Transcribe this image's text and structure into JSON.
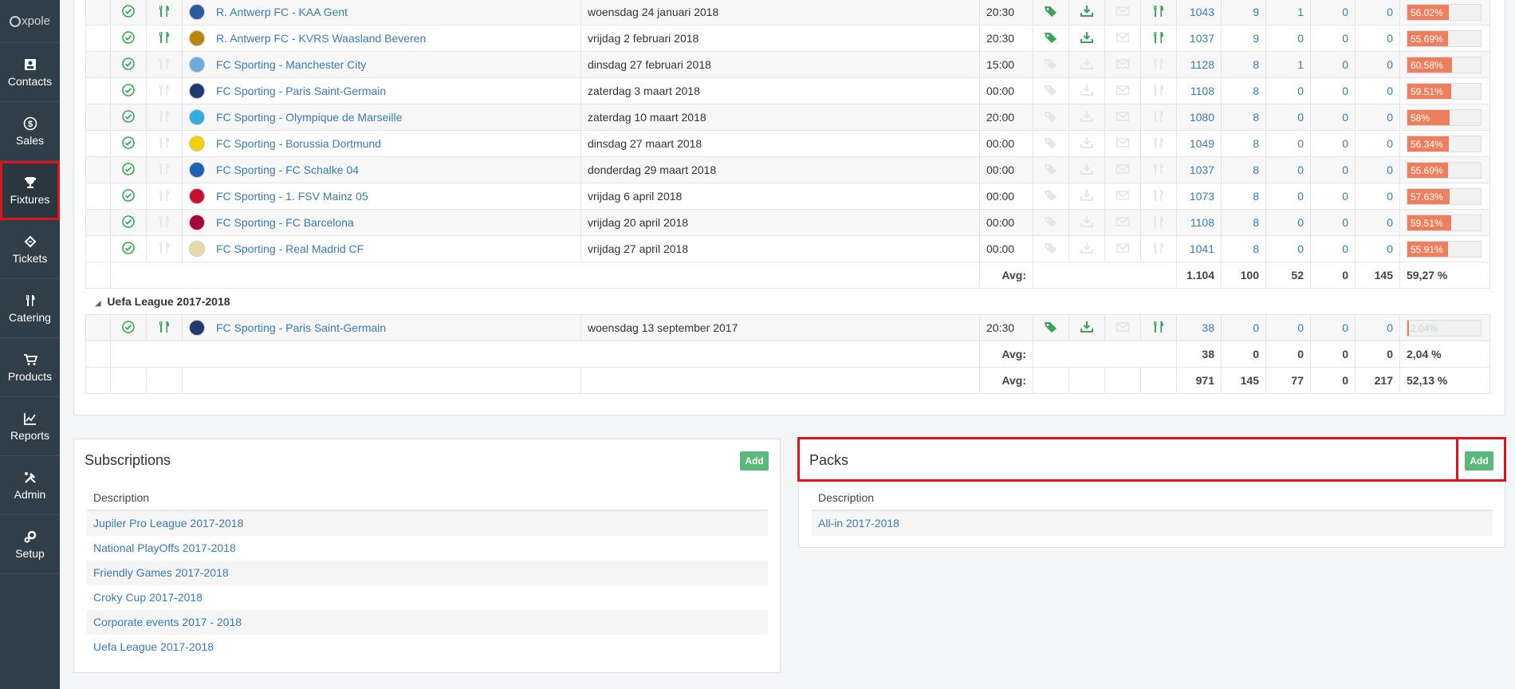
{
  "sidebar": {
    "logo": "xpole",
    "items": [
      {
        "label": "Contacts",
        "icon": "contacts-icon"
      },
      {
        "label": "Sales",
        "icon": "dollar-icon"
      },
      {
        "label": "Fixtures",
        "icon": "trophy-icon",
        "active": true
      },
      {
        "label": "Tickets",
        "icon": "ticket-icon"
      },
      {
        "label": "Catering",
        "icon": "cutlery-icon"
      },
      {
        "label": "Products",
        "icon": "cart-icon"
      },
      {
        "label": "Reports",
        "icon": "line-chart-icon"
      },
      {
        "label": "Admin",
        "icon": "tools-icon"
      },
      {
        "label": "Setup",
        "icon": "gears-icon"
      }
    ]
  },
  "fixtures": {
    "rows": [
      {
        "name": "R. Antwerp FC - KAA Gent",
        "date": "woensdag 24 januari 2018",
        "time": "20:30",
        "catering": true,
        "tags": true,
        "c1": "1043",
        "c2": "9",
        "c3": "1",
        "c4": "0",
        "c5": "0",
        "pct": "56.02%",
        "pct_value": 56.02,
        "club_color": "#2c5aa0"
      },
      {
        "name": "R. Antwerp FC - KVRS Waasland Beveren",
        "date": "vrijdag 2 februari 2018",
        "time": "20:30",
        "catering": true,
        "tags": true,
        "c1": "1037",
        "c2": "9",
        "c3": "0",
        "c4": "0",
        "c5": "0",
        "pct": "55.69%",
        "pct_value": 55.69,
        "club_color": "#b8860b"
      },
      {
        "name": "FC Sporting - Manchester City",
        "date": "dinsdag 27 februari 2018",
        "time": "15:00",
        "catering": false,
        "tags": false,
        "c1": "1128",
        "c2": "8",
        "c3": "1",
        "c4": "0",
        "c5": "0",
        "pct": "60.58%",
        "pct_value": 60.58,
        "club_color": "#6cabdd"
      },
      {
        "name": "FC Sporting - Paris Saint-Germain",
        "date": "zaterdag 3 maart 2018",
        "time": "00:00",
        "catering": false,
        "tags": false,
        "c1": "1108",
        "c2": "8",
        "c3": "0",
        "c4": "0",
        "c5": "0",
        "pct": "59.51%",
        "pct_value": 59.51,
        "club_color": "#1f3a6e"
      },
      {
        "name": "FC Sporting - Olympique de Marseille",
        "date": "zaterdag 10 maart 2018",
        "time": "20:00",
        "catering": false,
        "tags": false,
        "c1": "1080",
        "c2": "8",
        "c3": "0",
        "c4": "0",
        "c5": "0",
        "pct": "58%",
        "pct_value": 58,
        "club_color": "#2faee0"
      },
      {
        "name": "FC Sporting - Borussia Dortmund",
        "date": "dinsdag 27 maart 2018",
        "time": "00:00",
        "catering": false,
        "tags": false,
        "c1": "1049",
        "c2": "8",
        "c3": "0",
        "c4": "0",
        "c5": "0",
        "pct": "56.34%",
        "pct_value": 56.34,
        "club_color": "#f5d000"
      },
      {
        "name": "FC Sporting - FC Schalke 04",
        "date": "donderdag 29 maart 2018",
        "time": "00:00",
        "catering": false,
        "tags": false,
        "c1": "1037",
        "c2": "8",
        "c3": "0",
        "c4": "0",
        "c5": "0",
        "pct": "55.69%",
        "pct_value": 55.69,
        "club_color": "#1c63b7"
      },
      {
        "name": "FC Sporting - 1. FSV Mainz 05",
        "date": "vrijdag 6 april 2018",
        "time": "00:00",
        "catering": false,
        "tags": false,
        "c1": "1073",
        "c2": "8",
        "c3": "0",
        "c4": "0",
        "c5": "0",
        "pct": "57.63%",
        "pct_value": 57.63,
        "club_color": "#c8102e"
      },
      {
        "name": "FC Sporting - FC Barcelona",
        "date": "vrijdag 20 april 2018",
        "time": "00:00",
        "catering": false,
        "tags": false,
        "c1": "1108",
        "c2": "8",
        "c3": "0",
        "c4": "0",
        "c5": "0",
        "pct": "59.51%",
        "pct_value": 59.51,
        "club_color": "#a50044"
      },
      {
        "name": "FC Sporting - Real Madrid CF",
        "date": "vrijdag 27 april 2018",
        "time": "00:00",
        "catering": false,
        "tags": false,
        "c1": "1041",
        "c2": "8",
        "c3": "0",
        "c4": "0",
        "c5": "0",
        "pct": "55.91%",
        "pct_value": 55.91,
        "club_color": "#e8d9a8"
      }
    ],
    "avg1": {
      "label": "Avg:",
      "c1": "1.104",
      "c2": "100",
      "c3": "52",
      "c4": "0",
      "c5": "145",
      "pct": "59,27 %"
    },
    "group2": {
      "title": "Uefa League 2017-2018",
      "row": {
        "name": "FC Sporting - Paris Saint-Germain",
        "date": "woensdag 13 september 2017",
        "time": "20:30",
        "c1": "38",
        "c2": "0",
        "c3": "0",
        "c4": "0",
        "c5": "0",
        "pct": "2.04%",
        "pct_value": 2.04,
        "club_color": "#1f3a6e"
      }
    },
    "avg2": {
      "label": "Avg:",
      "c1": "38",
      "c2": "0",
      "c3": "0",
      "c4": "0",
      "c5": "0",
      "pct": "2,04 %"
    },
    "avg_total": {
      "label": "Avg:",
      "c1": "971",
      "c2": "145",
      "c3": "77",
      "c4": "0",
      "c5": "217",
      "pct": "52,13 %"
    }
  },
  "subscriptions": {
    "title": "Subscriptions",
    "add_label": "Add",
    "header": "Description",
    "items": [
      "Jupiler Pro League 2017-2018",
      "National PlayOffs 2017-2018",
      "Friendly Games 2017-2018",
      "Croky Cup 2017-2018",
      "Corporate events 2017 - 2018",
      "Uefa League 2017-2018"
    ]
  },
  "packs": {
    "title": "Packs",
    "add_label": "Add",
    "header": "Description",
    "items": [
      "All-in 2017-2018"
    ]
  },
  "colors": {
    "sidebar": "#2f3e48",
    "accent_green": "#5cb87a",
    "link": "#3a79b7",
    "progress": "#ee7f5e",
    "highlight": "#e0121b"
  }
}
